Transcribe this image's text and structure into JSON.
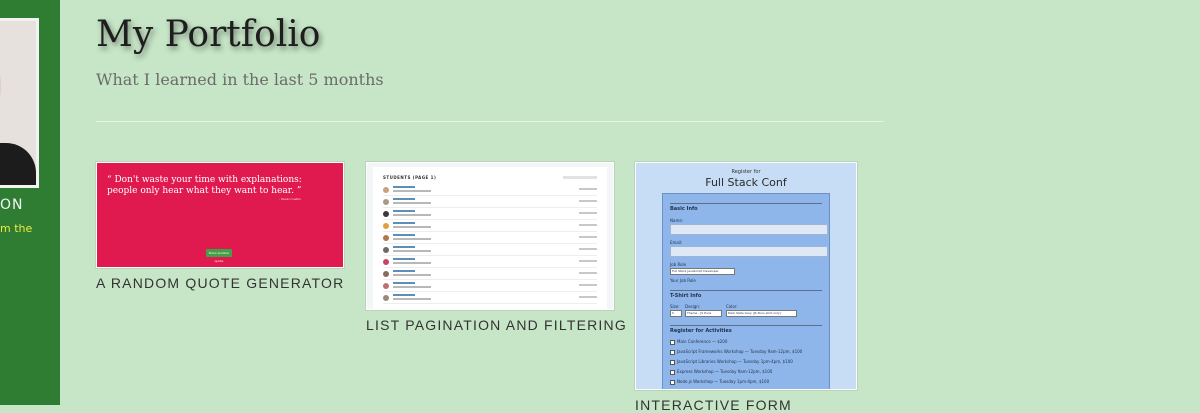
{
  "sidebar": {
    "name_fragment": "ON",
    "sub_fragment": "m the"
  },
  "header": {
    "title": "My Portfolio",
    "subtitle": "What I learned in the last 5 months"
  },
  "projects": [
    {
      "caption": "A RANDOM QUOTE GENERATOR",
      "quote_text": "“ Don't waste your time with explanations: people only hear what they want to hear. ”",
      "quote_author": "- Paulo Coelho",
      "button_label": "Show another quote"
    },
    {
      "caption": "LIST PAGINATION AND FILTERING",
      "heading": "STUDENTS (PAGE 1)"
    },
    {
      "caption": "INTERACTIVE FORM",
      "register_for": "Register for",
      "conf_title": "Full Stack Conf",
      "basic_info": "Basic Info",
      "name_label": "Name:",
      "email_label": "Email:",
      "job_role_label": "Job Role",
      "job_role_value": "Full Stack JavaScript Developer",
      "your_job_role": "Your Job Role",
      "tshirt_info": "T-Shirt Info",
      "size_label": "Size:",
      "size_value": "S",
      "design_label": "Design:",
      "design_value": "Theme - JS Puns",
      "color_label": "Color:",
      "color_value": "Dark Slate Grey (JS Puns shirt only)",
      "activities_heading": "Register for Activities",
      "activities": [
        "Main Conference — $200",
        "JavaScript Frameworks Workshop — Tuesday 9am-12pm, $100",
        "JavaScript Libraries Workshop — Tuesday 1pm-4pm, $100",
        "Express Workshop — Tuesday 9am-12pm, $100",
        "Node.js Workshop — Tuesday 1pm-4pm, $100"
      ]
    }
  ],
  "colors": {
    "page_bg": "#c7e6c7",
    "sidebar_bg": "#2e7d32",
    "quote_bg": "#e01a4f",
    "form_bg": "#8fb6ea"
  }
}
